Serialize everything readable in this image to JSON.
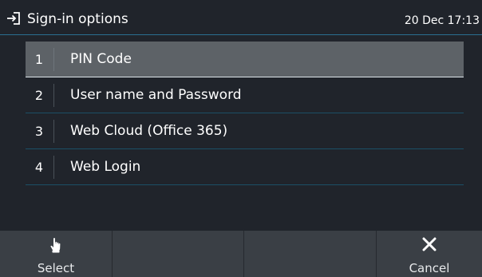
{
  "header": {
    "title": "Sign-in options",
    "datetime": "20 Dec 17:13",
    "icon": "sign-in-icon"
  },
  "options": [
    {
      "num": "1",
      "label": "PIN Code",
      "selected": true
    },
    {
      "num": "2",
      "label": "User name and Password",
      "selected": false
    },
    {
      "num": "3",
      "label": "Web Cloud (Office 365)",
      "selected": false
    },
    {
      "num": "4",
      "label": "Web Login",
      "selected": false
    }
  ],
  "softkeys": {
    "select_label": "Select",
    "select_icon": "hand-pointer-icon",
    "cancel_label": "Cancel",
    "cancel_icon": "close-icon"
  },
  "colors": {
    "background": "#20242b",
    "accent_line": "#2a6f91",
    "selected_row": "#5d6267",
    "softkey_bar": "#3a3f45"
  }
}
